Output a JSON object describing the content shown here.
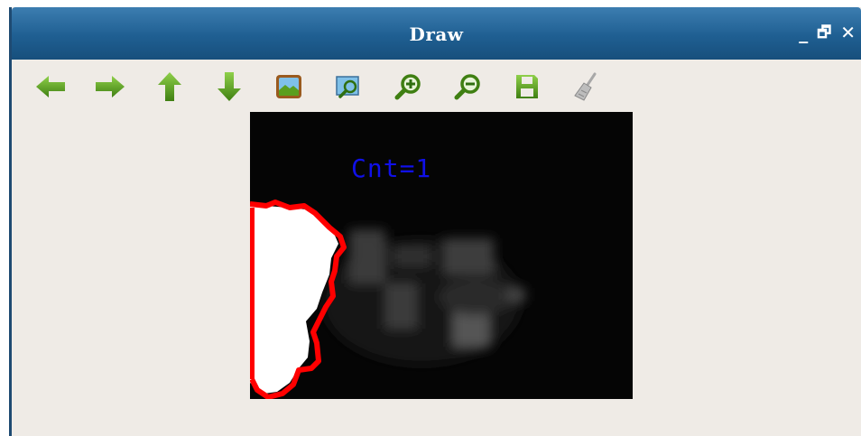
{
  "window": {
    "title": "Draw",
    "controls": {
      "minimize": "_",
      "restore": "🗗",
      "close": "✕"
    }
  },
  "toolbar": {
    "buttons": [
      {
        "name": "back",
        "icon": "arrow-left-icon"
      },
      {
        "name": "forward",
        "icon": "arrow-right-icon"
      },
      {
        "name": "up",
        "icon": "arrow-up-icon"
      },
      {
        "name": "down",
        "icon": "arrow-down-icon"
      },
      {
        "name": "image",
        "icon": "image-icon"
      },
      {
        "name": "zoom-fit",
        "icon": "zoom-fit-icon"
      },
      {
        "name": "zoom-in",
        "icon": "zoom-in-icon"
      },
      {
        "name": "zoom-out",
        "icon": "zoom-out-icon"
      },
      {
        "name": "save",
        "icon": "save-icon"
      },
      {
        "name": "clear",
        "icon": "broom-icon"
      }
    ]
  },
  "canvas": {
    "overlay_text": "Cnt=1",
    "overlay_color": "#1010e8",
    "contour_color": "#ff0000"
  },
  "colors": {
    "titlebar": "#1f5f92",
    "icon_green": "#5a9e1e",
    "background": "#efebe6"
  }
}
